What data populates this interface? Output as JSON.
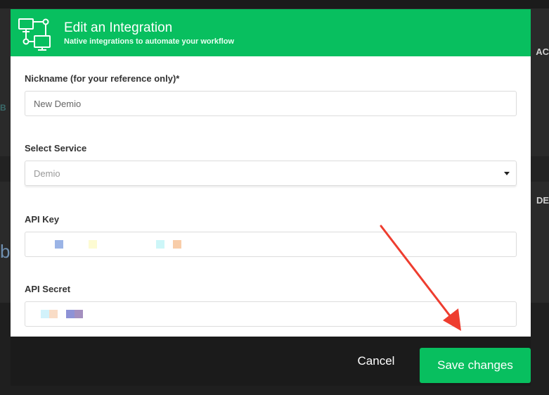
{
  "modal": {
    "title": "Edit an Integration",
    "subtitle": "Native integrations to automate your workflow",
    "header_icon": "network-integration-icon"
  },
  "form": {
    "nickname": {
      "label": "Nickname (for your reference only)*",
      "value": "New Demio"
    },
    "service": {
      "label": "Select Service",
      "selected": "Demio"
    },
    "api_key": {
      "label": "API Key",
      "value_masked": true
    },
    "api_secret": {
      "label": "API Secret",
      "value_masked": true
    }
  },
  "footer": {
    "cancel_label": "Cancel",
    "save_label": "Save changes"
  },
  "backdrop": {
    "right_text_1": "AC",
    "right_text_2": "DE",
    "left_text_1": "B",
    "left_text_2": "b"
  },
  "colors": {
    "accent": "#08bf5f",
    "footer_bg": "#1b1b1b",
    "annotation_arrow": "#ee3d2f"
  }
}
